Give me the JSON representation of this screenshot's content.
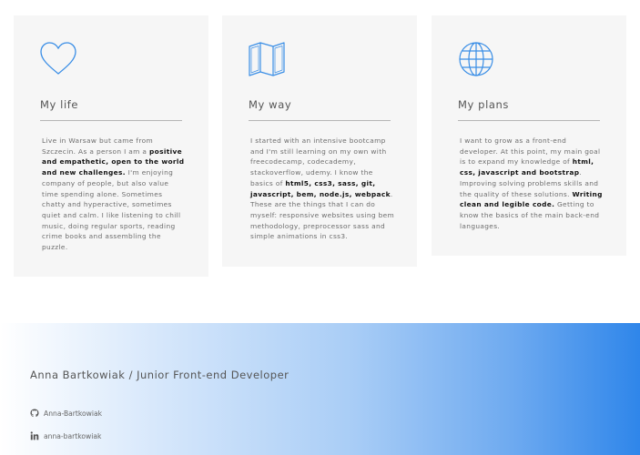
{
  "cards": [
    {
      "icon": "heart-icon",
      "title": "My life",
      "segments": [
        {
          "text": "Live in Warsaw but came from Szczecin. As a person I am a ",
          "bold": false
        },
        {
          "text": "positive and empathetic, open to the world and new challenges.",
          "bold": true
        },
        {
          "text": " I'm enjoying company of people, but also value time spending alone. Sometimes chatty and hyperactive, sometimes quiet and calm. I like listening to chill music, doing regular sports, reading crime books and assembling the puzzle.",
          "bold": false
        }
      ]
    },
    {
      "icon": "map-icon",
      "title": "My way",
      "segments": [
        {
          "text": "I started with an intensive bootcamp and I'm still learning on my own with freecodecamp, codecademy, stackoverflow, udemy. I know the basics of ",
          "bold": false
        },
        {
          "text": "html5, css3, sass, git, javascript, bem, node.js, webpack",
          "bold": true
        },
        {
          "text": ". These are the things that I can do myself: responsive websites using bem methodology, preprocessor sass and simple animations in css3.",
          "bold": false
        }
      ]
    },
    {
      "icon": "globe-icon",
      "title": "My plans",
      "segments": [
        {
          "text": "I want to grow as a front-end developer. At this point, my main goal is to expand my knowledge of ",
          "bold": false
        },
        {
          "text": "html, css, javascript and bootstrap",
          "bold": true
        },
        {
          "text": ". Improving solving problems skills and the quality of these solutions. ",
          "bold": false
        },
        {
          "text": "Writing clean and legible code.",
          "bold": true
        },
        {
          "text": " Getting to know the basics of the main back-end languages.",
          "bold": false
        }
      ]
    }
  ],
  "footer": {
    "name": "Anna Bartkowiak / Junior Front-end Developer",
    "links": [
      {
        "icon": "github-icon",
        "label": "Anna-Bartkowiak"
      },
      {
        "icon": "linkedin-icon",
        "label": "anna-bartkowiak"
      }
    ]
  },
  "colors": {
    "icon_blue": "#3a8ee6",
    "card_bg": "#f6f6f6",
    "gradient_end": "#2f86ea"
  }
}
